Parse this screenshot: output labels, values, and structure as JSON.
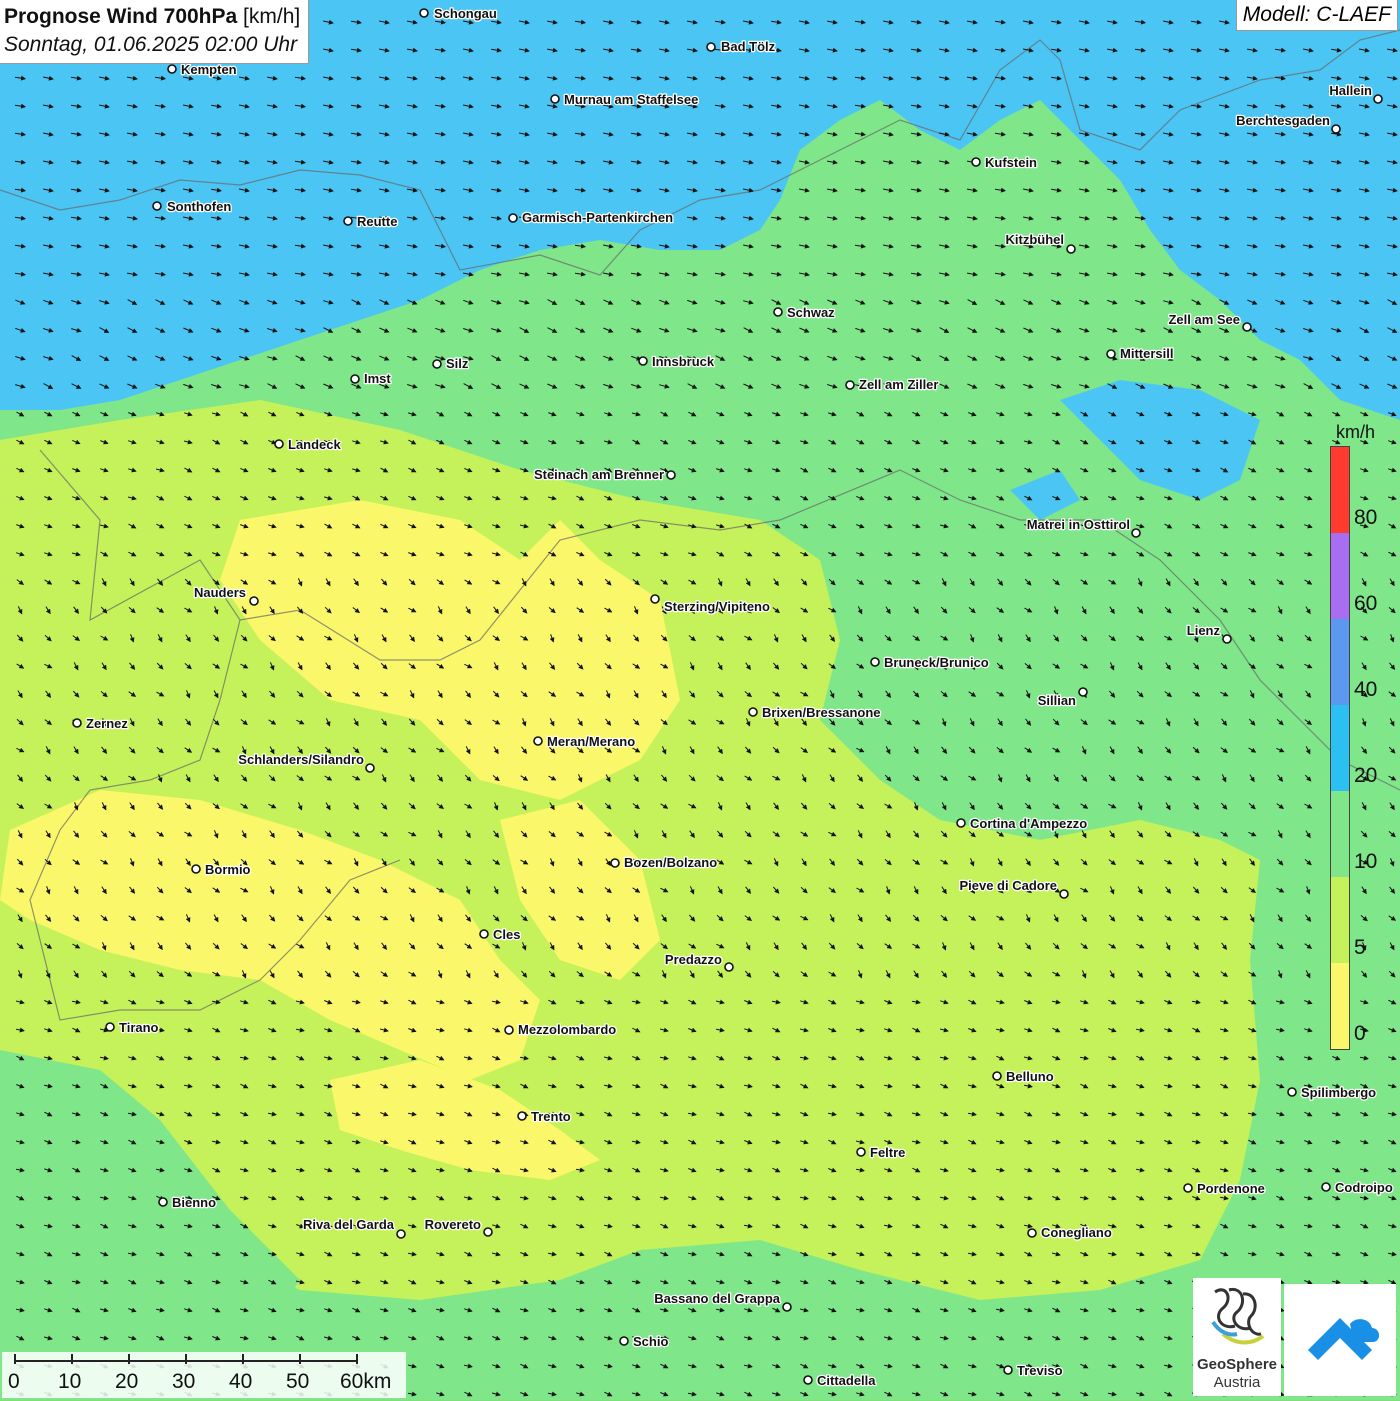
{
  "title": {
    "main": "Prognose Wind 700hPa",
    "unit": "[km/h]",
    "datetime": "Sonntag, 01.06.2025 02:00 Uhr"
  },
  "model": "Modell: C-LAEF",
  "legend": {
    "unit": "km/h",
    "ticks": [
      "80",
      "60",
      "40",
      "20",
      "10",
      "5",
      "0"
    ],
    "colors": {
      "above_80": "#ff3b30",
      "60_80": "#a86df0",
      "40_60": "#5c98f0",
      "20_40": "#2bbff2",
      "10_20": "#7fe68a",
      "5_10": "#c5f25a",
      "0_5": "#fbf76a"
    }
  },
  "scale_bar": {
    "labels": [
      "0",
      "10",
      "20",
      "30",
      "40",
      "50",
      "60km"
    ]
  },
  "logos": {
    "geosphere_line1": "GeoSphere",
    "geosphere_line2": "Austria"
  },
  "cities": [
    {
      "name": "Schongau"
    },
    {
      "name": "Bad Tölz"
    },
    {
      "name": "Kempten"
    },
    {
      "name": "Murnau am Staffelsee"
    },
    {
      "name": "Hallein"
    },
    {
      "name": "Berchtesgaden"
    },
    {
      "name": "Kufstein"
    },
    {
      "name": "Sonthofen"
    },
    {
      "name": "Reutte"
    },
    {
      "name": "Garmisch-Partenkirchen"
    },
    {
      "name": "Kitzbühel"
    },
    {
      "name": "Schwaz"
    },
    {
      "name": "Zell am See"
    },
    {
      "name": "Mittersill"
    },
    {
      "name": "Silz"
    },
    {
      "name": "Innsbruck"
    },
    {
      "name": "Imst"
    },
    {
      "name": "Zell am Ziller"
    },
    {
      "name": "Landeck"
    },
    {
      "name": "Steinach am Brenner"
    },
    {
      "name": "Matrei in Osttirol"
    },
    {
      "name": "Nauders"
    },
    {
      "name": "Sterzing/Vipiteno"
    },
    {
      "name": "Lienz"
    },
    {
      "name": "Bruneck/Brunico"
    },
    {
      "name": "Sillian"
    },
    {
      "name": "Zernez"
    },
    {
      "name": "Brixen/Bressanone"
    },
    {
      "name": "Meran/Merano"
    },
    {
      "name": "Schlanders/Silandro"
    },
    {
      "name": "Cortina d'Ampezzo"
    },
    {
      "name": "Bozen/Bolzano"
    },
    {
      "name": "Bormio"
    },
    {
      "name": "Pieve di Cadore"
    },
    {
      "name": "Cles"
    },
    {
      "name": "Predazzo"
    },
    {
      "name": "Tirano"
    },
    {
      "name": "Mezzolombardo"
    },
    {
      "name": "Belluno"
    },
    {
      "name": "Spilimbergo"
    },
    {
      "name": "Trento"
    },
    {
      "name": "Feltre"
    },
    {
      "name": "Bienno"
    },
    {
      "name": "Pordenone"
    },
    {
      "name": "Codroipo"
    },
    {
      "name": "Riva del Garda"
    },
    {
      "name": "Rovereto"
    },
    {
      "name": "Conegliano"
    },
    {
      "name": "Bassano del Grappa"
    },
    {
      "name": "Schio"
    },
    {
      "name": "Treviso"
    },
    {
      "name": "Cittadella"
    }
  ]
}
